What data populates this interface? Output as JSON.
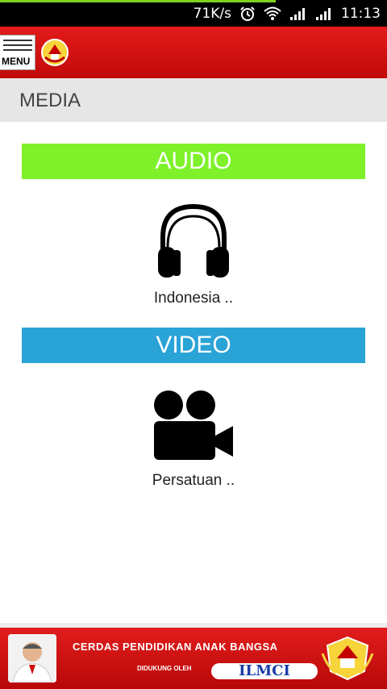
{
  "status_bar": {
    "speed": "71K/s",
    "time": "11:13",
    "icons": [
      "alarm-icon",
      "wifi-icon",
      "signal-icon",
      "signal-icon"
    ]
  },
  "app_bar": {
    "menu_label": "MENU"
  },
  "page": {
    "title": "MEDIA"
  },
  "sections": {
    "audio": {
      "header": "AUDIO",
      "header_color": "#7ef12a",
      "items": [
        {
          "caption": "Indonesia ..",
          "icon": "headphones-icon"
        }
      ]
    },
    "video": {
      "header": "VIDEO",
      "header_color": "#2aa3d6",
      "items": [
        {
          "caption": "Persatuan ..",
          "icon": "video-camera-icon"
        }
      ]
    }
  },
  "banner": {
    "headline": "CERDAS PENDIDIKAN ANAK BANGSA",
    "supported_by": "DIDUKUNG OLEH",
    "logo_text": "ILMCI"
  },
  "colors": {
    "app_bar": "#d91212",
    "title_bar": "#e6e6e6"
  }
}
